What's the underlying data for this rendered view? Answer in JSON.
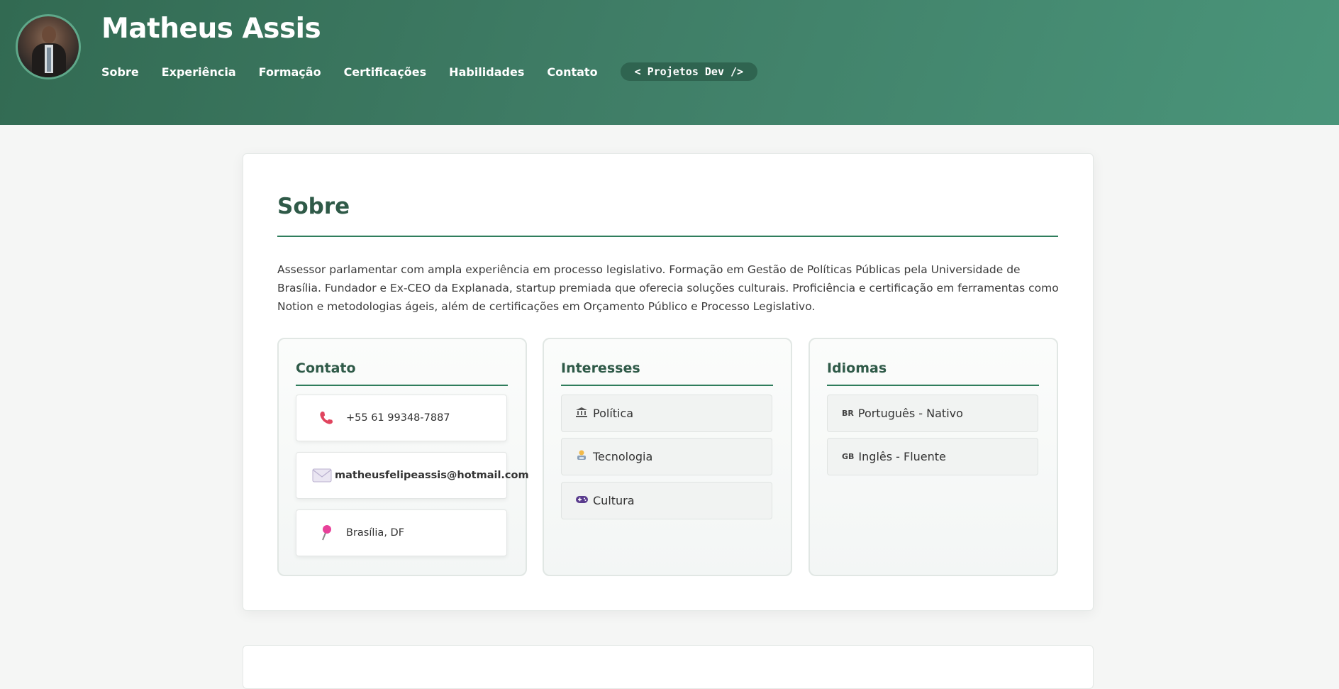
{
  "header": {
    "name": "Matheus Assis",
    "nav": [
      "Sobre",
      "Experiência",
      "Formação",
      "Certificações",
      "Habilidades",
      "Contato"
    ],
    "dev_button": "< Projetos Dev />"
  },
  "about": {
    "title": "Sobre",
    "text": "Assessor parlamentar com ampla experiência em processo legislativo. Formação em Gestão de Políticas Públicas pela Universidade de Brasília. Fundador e Ex-CEO da Explanada, startup premiada que oferecia soluções culturais. Proficiência e certificação em ferramentas como Notion e metodologias ágeis, além de certificações em Orçamento Público e Processo Legislativo."
  },
  "contact": {
    "title": "Contato",
    "items": [
      {
        "icon": "phone-icon",
        "text": "+55 61 99348-7887"
      },
      {
        "icon": "envelope-icon",
        "text": "matheusfelipeassis@hotmail.com"
      },
      {
        "icon": "pin-icon",
        "text": "Brasília, DF"
      }
    ]
  },
  "interests": {
    "title": "Interesses",
    "items": [
      {
        "icon": "classical-building-icon",
        "text": "Política"
      },
      {
        "icon": "technologist-icon",
        "text": "Tecnologia"
      },
      {
        "icon": "game-controller-icon",
        "text": "Cultura"
      }
    ]
  },
  "languages": {
    "title": "Idiomas",
    "items": [
      {
        "flag": "BR",
        "text": "Português - Nativo"
      },
      {
        "flag": "GB",
        "text": "Inglês - Fluente"
      }
    ]
  },
  "colors": {
    "header_start": "#326a52",
    "header_end": "#4a957a",
    "accent": "#2f7d5c",
    "title": "#2f5a48"
  }
}
